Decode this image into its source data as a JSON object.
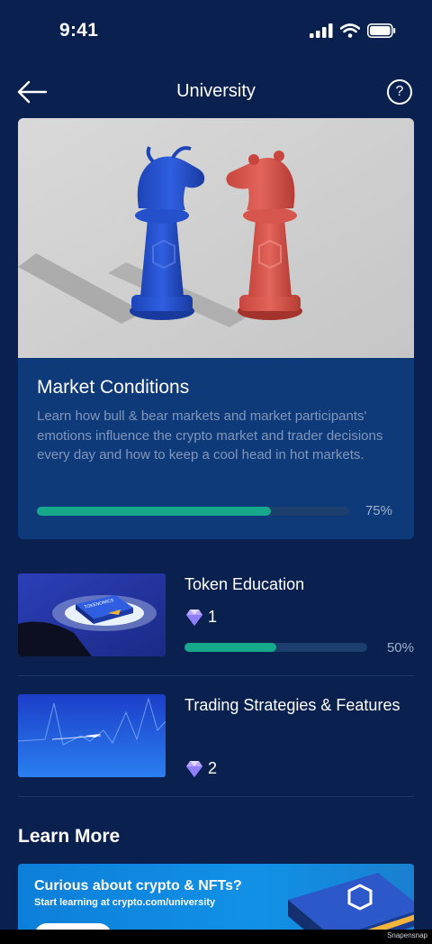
{
  "status": {
    "time": "9:41"
  },
  "header": {
    "title": "University",
    "help_label": "?"
  },
  "featured": {
    "title": "Market Conditions",
    "description": "Learn how bull & bear markets and market participants' emotions influence the crypto market and trader decisions every day and how to keep a cool head in hot markets.",
    "progress": 0.75,
    "progress_label": "75%"
  },
  "courses": [
    {
      "title": "Token Education",
      "gems": "1",
      "progress": 0.5,
      "progress_label": "50%",
      "book_label": "TOKENOMICS"
    },
    {
      "title": "Trading Strategies & Features",
      "gems": "2"
    }
  ],
  "learn_more": {
    "title": "Learn More",
    "banner_title": "Curious about crypto & NFTs?",
    "banner_sub": "Start learning at crypto.com/university"
  },
  "watermark": "Snapensnap",
  "colors": {
    "background": "#0a2150",
    "card": "#0f3a79",
    "accent": "#17a98b",
    "muted_text": "#8097bb",
    "bull": "#2a56d6",
    "bear": "#d9544c"
  }
}
